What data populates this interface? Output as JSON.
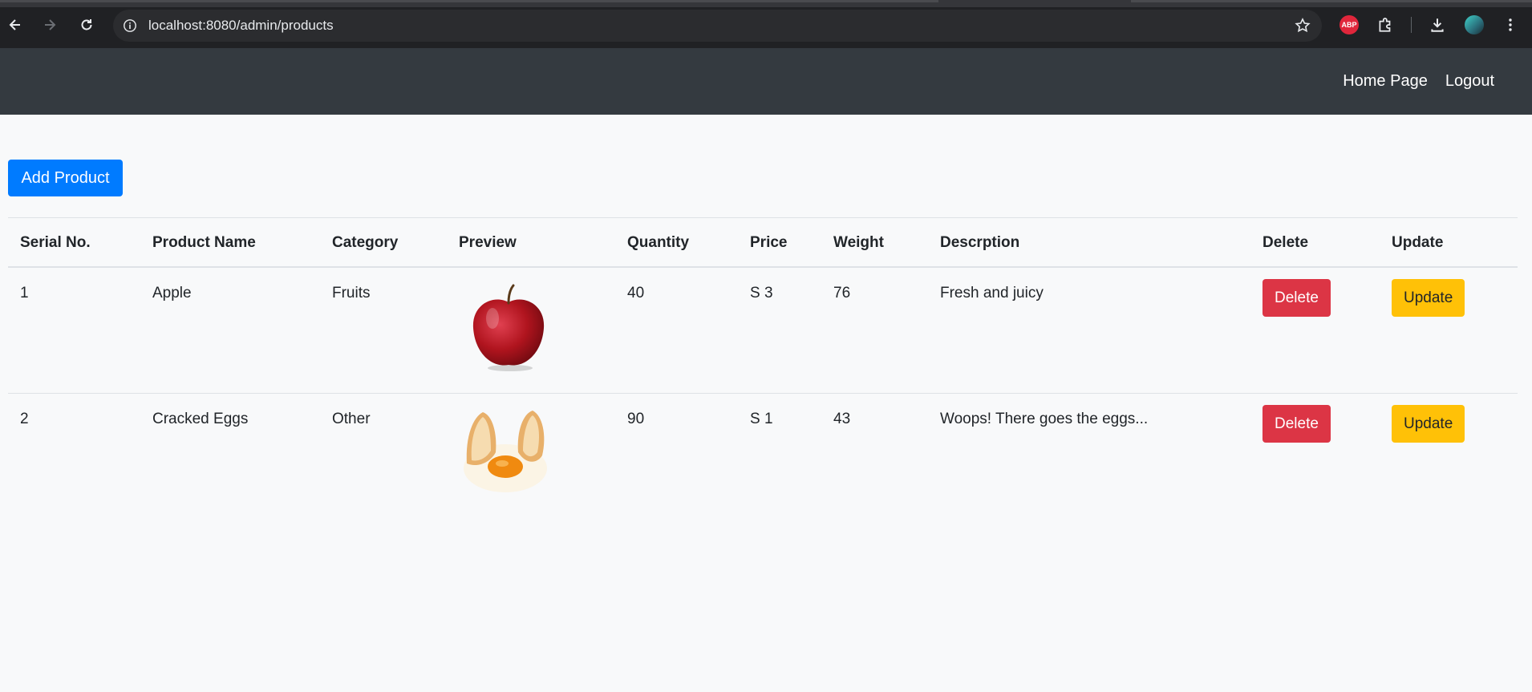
{
  "browser": {
    "url": "localhost:8080/admin/products",
    "extensions": [
      "adblock-plus-icon",
      "puzzle-extension-icon",
      "download-icon",
      "profile-avatar"
    ],
    "abp_label": "ABP"
  },
  "navbar": {
    "links": [
      "Home Page",
      "Logout"
    ]
  },
  "add_button": "Add Product",
  "table": {
    "headers": [
      "Serial No.",
      "Product Name",
      "Category",
      "Preview",
      "Quantity",
      "Price",
      "Weight",
      "Descrption",
      "Delete",
      "Update"
    ],
    "rows": [
      {
        "serial": "1",
        "name": "Apple",
        "category": "Fruits",
        "preview": "apple-image",
        "quantity": "40",
        "price": "S 3",
        "weight": "76",
        "description": "Fresh and juicy",
        "delete_label": "Delete",
        "update_label": "Update"
      },
      {
        "serial": "2",
        "name": "Cracked Eggs",
        "category": "Other",
        "preview": "cracked-egg-image",
        "quantity": "90",
        "price": "S 1",
        "weight": "43",
        "description": "Woops! There goes the eggs...",
        "delete_label": "Delete",
        "update_label": "Update"
      }
    ]
  },
  "colors": {
    "navbar": "#343a40",
    "primary": "#007bff",
    "danger": "#dc3545",
    "warning": "#ffc107",
    "page_bg": "#f8f9fa"
  }
}
